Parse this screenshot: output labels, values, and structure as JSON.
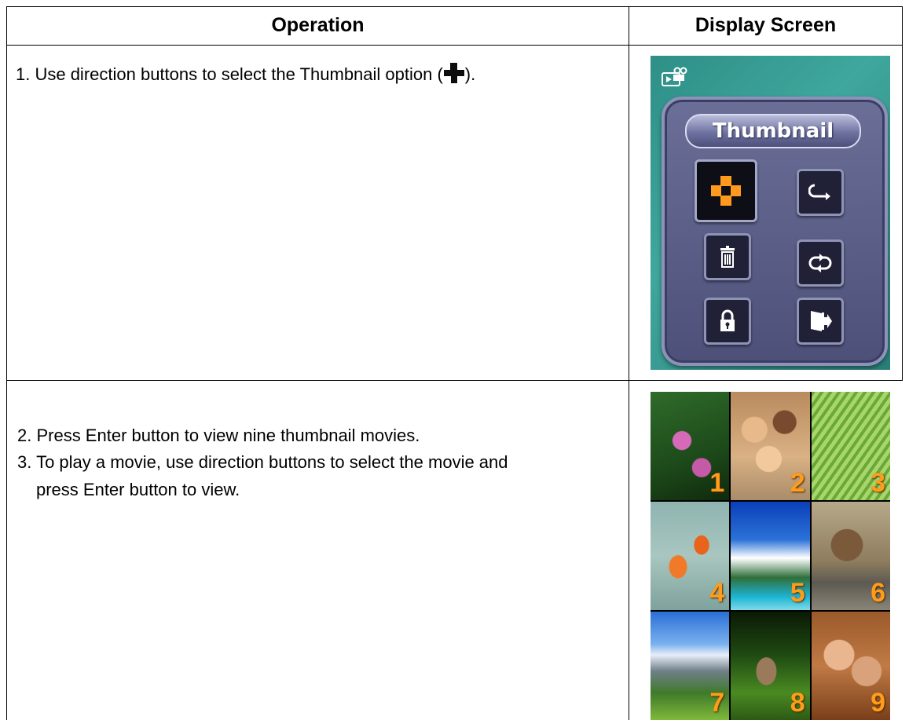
{
  "table": {
    "headers": {
      "operation": "Operation",
      "display": "Display Screen"
    },
    "rows": [
      {
        "steps": [
          {
            "before_icon": "1. Use direction buttons to select the Thumbnail option (",
            "icon": "thumbnail-icon",
            "after_icon": ")."
          }
        ]
      },
      {
        "steps": [
          "2. Press Enter button to view nine thumbnail movies.",
          "3. To play a movie, use direction buttons to select the movie and",
          "press Enter button to view."
        ]
      }
    ]
  },
  "menu_screen": {
    "title": "Thumbnail",
    "camera_icon": "movie-playback-icon",
    "buttons": [
      {
        "icon": "thumbnail-icon",
        "selected": true
      },
      {
        "icon": "repeat-one-icon",
        "selected": false
      },
      {
        "icon": "delete-icon",
        "selected": false
      },
      {
        "icon": "repeat-all-icon",
        "selected": false
      },
      {
        "icon": "lock-icon",
        "selected": false
      },
      {
        "icon": "exit-icon",
        "selected": false
      }
    ],
    "colors": {
      "background": "#3fa79d",
      "panel": "#5a5e88",
      "selected_accent": "#ff9a1e"
    }
  },
  "thumbnails": {
    "numbers": [
      "1",
      "2",
      "3",
      "4",
      "5",
      "6",
      "7",
      "8",
      "9"
    ],
    "number_color": "#ff9d1a"
  }
}
